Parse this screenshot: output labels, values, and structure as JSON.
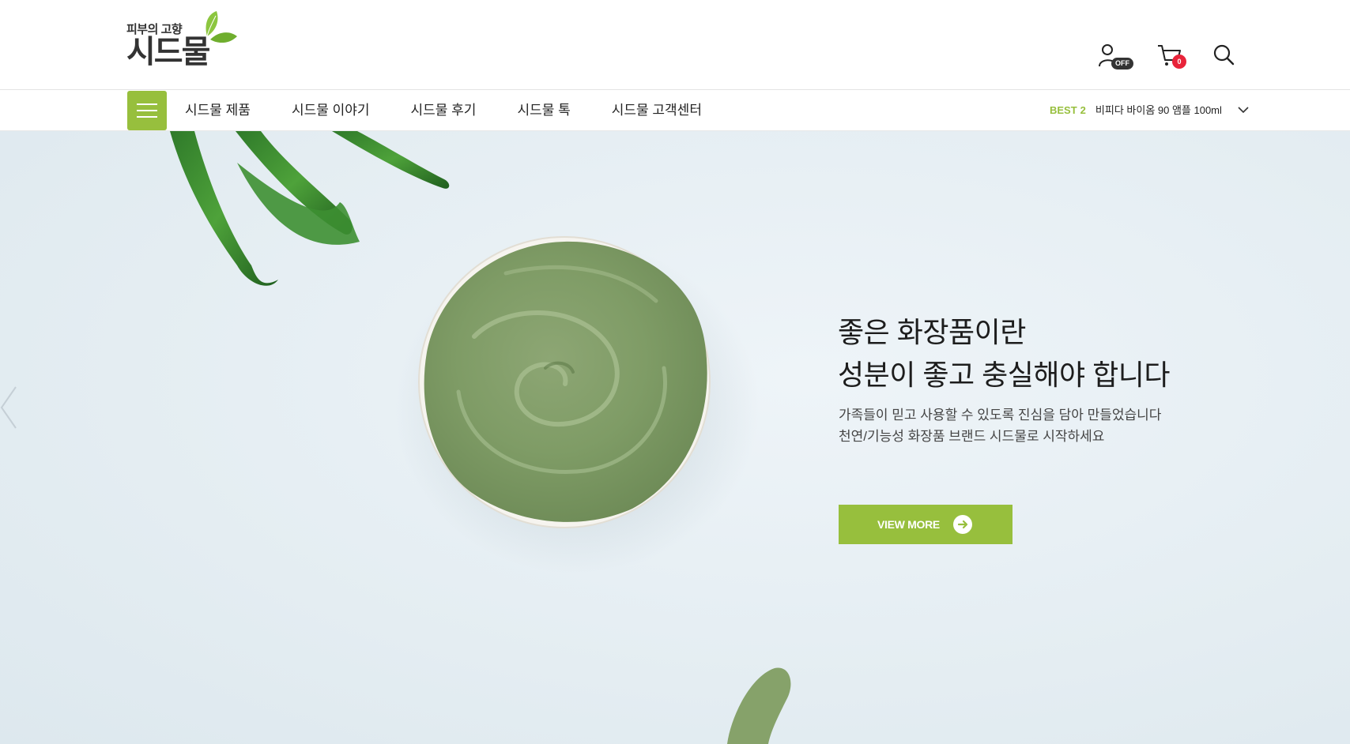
{
  "header": {
    "logo": {
      "tagline": "피부의 고향",
      "brand": "시드물"
    },
    "icons": {
      "user_badge": "OFF",
      "cart_count": "0"
    }
  },
  "nav": {
    "items": [
      "시드물 제품",
      "시드물 이야기",
      "시드물 후기",
      "시드물 톡",
      "시드물 고객센터"
    ],
    "best": {
      "label": "BEST",
      "rank": "2",
      "product": "비피다 바이옴 90 앰플 100ml"
    }
  },
  "hero": {
    "title_line1": "좋은 화장품이란",
    "title_line2": "성분이 좋고 충실해야 합니다",
    "desc_line1": "가족들이 믿고 사용할 수 있도록 진심을 담아 만들었습니다",
    "desc_line2": "천연/기능성 화장품 브랜드 시드물로 시작하세요",
    "cta_label": "VIEW MORE"
  },
  "colors": {
    "accent": "#97bf3d",
    "badge_red": "#e8243a",
    "text_dark": "#222222",
    "hero_bg": "#e4edf2"
  }
}
